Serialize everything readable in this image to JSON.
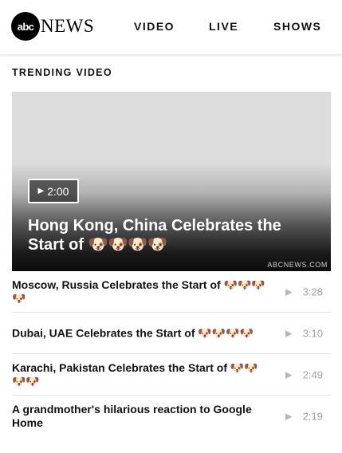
{
  "header": {
    "logo_circle_text": "abc",
    "logo_word": "NEWS",
    "nav": [
      {
        "label": "VIDEO"
      },
      {
        "label": "LIVE"
      },
      {
        "label": "SHOWS"
      }
    ]
  },
  "section_title": "TRENDING VIDEO",
  "hero": {
    "duration": "2:00",
    "play_icon": "play-triangle-icon",
    "title": "Hong Kong, China Celebrates the Start of 🐶🐶🐶🐶",
    "source": "ABCNEWS.COM"
  },
  "videos": [
    {
      "title": "Moscow, Russia Celebrates the Start of 🐶🐶🐶🐶",
      "duration": "3:28"
    },
    {
      "title": "Dubai, UAE Celebrates the Start of 🐶🐶🐶🐶",
      "duration": "3:10"
    },
    {
      "title": "Karachi, Pakistan Celebrates the Start of 🐶🐶🐶🐶",
      "duration": "2:49"
    },
    {
      "title": "A grandmother's hilarious reaction to Google Home",
      "duration": "2:19"
    }
  ],
  "colors": {
    "header_bg": "#ffffff",
    "text": "#111111",
    "muted": "#a0a0a0",
    "divider": "#e3e3e3"
  }
}
